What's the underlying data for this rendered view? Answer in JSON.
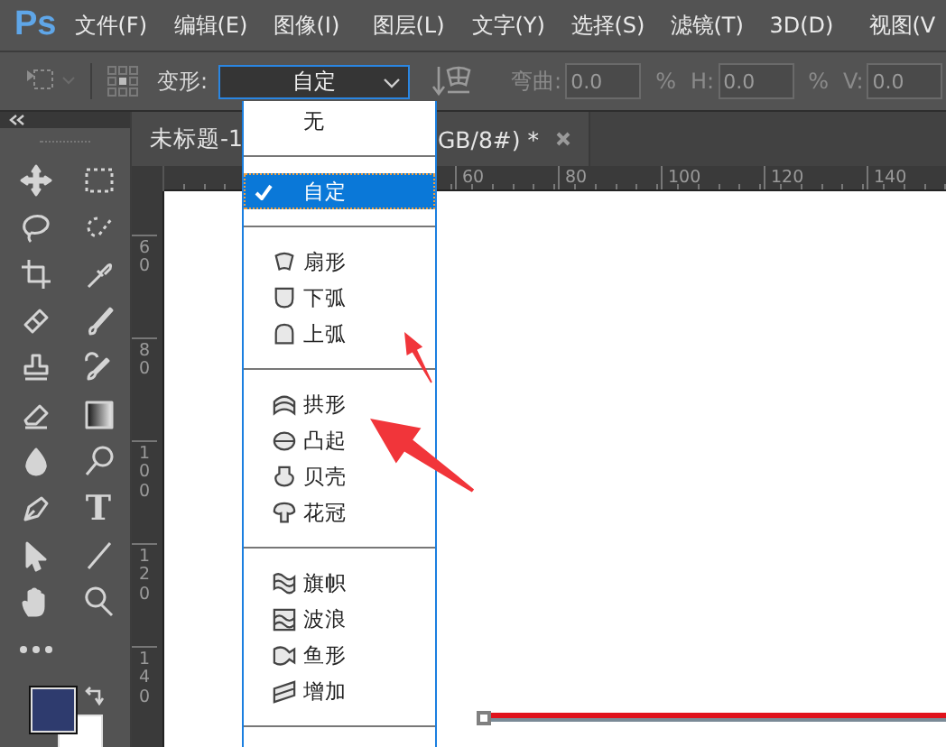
{
  "app": {
    "logo": "Ps"
  },
  "menu_bar": [
    "文件(F)",
    "编辑(E)",
    "图像(I)",
    "图层(L)",
    "文字(Y)",
    "选择(S)",
    "滤镜(T)",
    "3D(D)",
    "视图(V"
  ],
  "options_bar": {
    "warp": {
      "label": "变形:",
      "value": "自定",
      "open": true
    },
    "fields": [
      {
        "label": "弯曲:",
        "value": "0.0",
        "unit": "%",
        "disabled": true
      },
      {
        "label": "H:",
        "value": "0.0",
        "unit": "%",
        "disabled": true
      },
      {
        "label": "V:",
        "value": "0.0",
        "disabled": true
      }
    ]
  },
  "tools": {
    "type_tool": "T"
  },
  "swatches": [
    {
      "color": "#2e3b6e"
    },
    {
      "color": "#ffffff"
    }
  ],
  "document_tab": {
    "title_start": "未标题-1",
    "title_end": "GB/8#) *"
  },
  "rulers": {
    "horizontal": [
      "60",
      "80",
      "100",
      "120",
      "140"
    ],
    "vertical": [
      "60",
      "80",
      "100",
      "120",
      "140"
    ]
  },
  "warp_menu": {
    "groups": [
      {
        "items": [
          {
            "label": "无",
            "selected": false
          }
        ]
      },
      {
        "items": [
          {
            "label": "自定",
            "selected": true
          }
        ]
      },
      {
        "items": [
          {
            "label": "扇形",
            "selected": false
          },
          {
            "label": "下弧",
            "selected": false
          },
          {
            "label": "上弧",
            "selected": false
          }
        ]
      },
      {
        "items": [
          {
            "label": "拱形",
            "selected": false
          },
          {
            "label": "凸起",
            "selected": false
          },
          {
            "label": "贝壳",
            "selected": false
          },
          {
            "label": "花冠",
            "selected": false
          }
        ]
      },
      {
        "items": [
          {
            "label": "旗帜",
            "selected": false
          },
          {
            "label": "波浪",
            "selected": false
          },
          {
            "label": "鱼形",
            "selected": false
          },
          {
            "label": "增加",
            "selected": false
          }
        ]
      }
    ]
  }
}
